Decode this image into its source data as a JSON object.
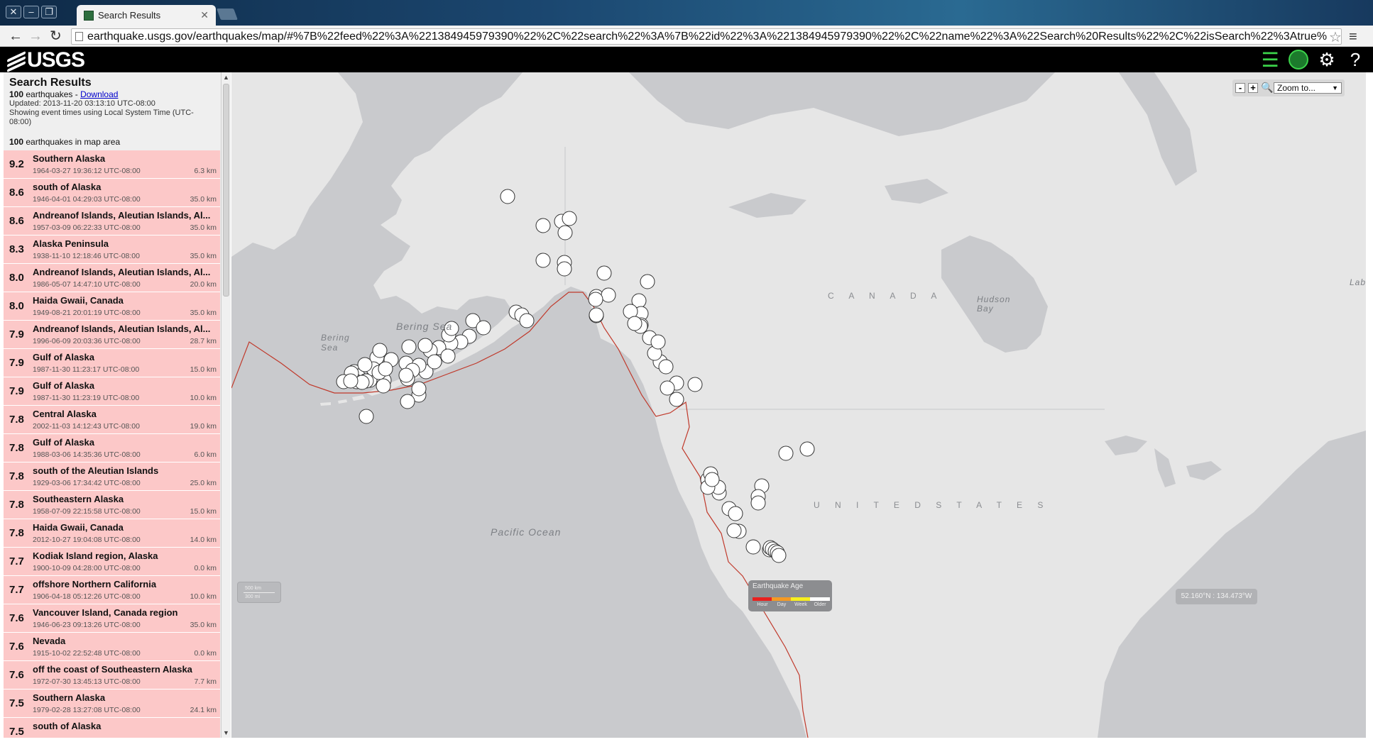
{
  "browser": {
    "tab_title": "Search Results",
    "url": "earthquake.usgs.gov/earthquakes/map/#%7B%22feed%22%3A%221384945979390%22%2C%22search%22%3A%7B%22id%22%3A%221384945979390%22%2C%22name%22%3A%22Search%20Results%22%2C%22isSearch%22%3Atrue%"
  },
  "header": {
    "logo": "USGS"
  },
  "sidebar": {
    "title": "Search Results",
    "count": "100",
    "count_suffix": " earthquakes - ",
    "download_label": "Download",
    "updated": "Updated: 2013-11-20 03:13:10 UTC-08:00",
    "timezone_note": "Showing event times using Local System Time (UTC-08:00)",
    "area_count": "100",
    "area_suffix": " earthquakes in map area",
    "earthquakes": [
      {
        "mag": "9.2",
        "place": "Southern Alaska",
        "time": "1964-03-27 19:36:12 UTC-08:00",
        "depth": "6.3 km"
      },
      {
        "mag": "8.6",
        "place": "south of Alaska",
        "time": "1946-04-01 04:29:03 UTC-08:00",
        "depth": "35.0 km"
      },
      {
        "mag": "8.6",
        "place": "Andreanof Islands, Aleutian Islands, Al...",
        "time": "1957-03-09 06:22:33 UTC-08:00",
        "depth": "35.0 km"
      },
      {
        "mag": "8.3",
        "place": "Alaska Peninsula",
        "time": "1938-11-10 12:18:46 UTC-08:00",
        "depth": "35.0 km"
      },
      {
        "mag": "8.0",
        "place": "Andreanof Islands, Aleutian Islands, Al...",
        "time": "1986-05-07 14:47:10 UTC-08:00",
        "depth": "20.0 km"
      },
      {
        "mag": "8.0",
        "place": "Haida Gwaii, Canada",
        "time": "1949-08-21 20:01:19 UTC-08:00",
        "depth": "35.0 km"
      },
      {
        "mag": "7.9",
        "place": "Andreanof Islands, Aleutian Islands, Al...",
        "time": "1996-06-09 20:03:36 UTC-08:00",
        "depth": "28.7 km"
      },
      {
        "mag": "7.9",
        "place": "Gulf of Alaska",
        "time": "1987-11-30 11:23:17 UTC-08:00",
        "depth": "15.0 km"
      },
      {
        "mag": "7.9",
        "place": "Gulf of Alaska",
        "time": "1987-11-30 11:23:19 UTC-08:00",
        "depth": "10.0 km"
      },
      {
        "mag": "7.8",
        "place": "Central Alaska",
        "time": "2002-11-03 14:12:43 UTC-08:00",
        "depth": "19.0 km"
      },
      {
        "mag": "7.8",
        "place": "Gulf of Alaska",
        "time": "1988-03-06 14:35:36 UTC-08:00",
        "depth": "6.0 km"
      },
      {
        "mag": "7.8",
        "place": "south of the Aleutian Islands",
        "time": "1929-03-06 17:34:42 UTC-08:00",
        "depth": "25.0 km"
      },
      {
        "mag": "7.8",
        "place": "Southeastern Alaska",
        "time": "1958-07-09 22:15:58 UTC-08:00",
        "depth": "15.0 km"
      },
      {
        "mag": "7.8",
        "place": "Haida Gwaii, Canada",
        "time": "2012-10-27 19:04:08 UTC-08:00",
        "depth": "14.0 km"
      },
      {
        "mag": "7.7",
        "place": "Kodiak Island region, Alaska",
        "time": "1900-10-09 04:28:00 UTC-08:00",
        "depth": "0.0 km"
      },
      {
        "mag": "7.7",
        "place": "offshore Northern California",
        "time": "1906-04-18 05:12:26 UTC-08:00",
        "depth": "10.0 km"
      },
      {
        "mag": "7.6",
        "place": "Vancouver Island, Canada region",
        "time": "1946-06-23 09:13:26 UTC-08:00",
        "depth": "35.0 km"
      },
      {
        "mag": "7.6",
        "place": "Nevada",
        "time": "1915-10-02 22:52:48 UTC-08:00",
        "depth": "0.0 km"
      },
      {
        "mag": "7.6",
        "place": "off the coast of Southeastern Alaska",
        "time": "1972-07-30 13:45:13 UTC-08:00",
        "depth": "7.7 km"
      },
      {
        "mag": "7.5",
        "place": "Southern Alaska",
        "time": "1979-02-28 13:27:08 UTC-08:00",
        "depth": "24.1 km"
      },
      {
        "mag": "7.5",
        "place": "south of Alaska",
        "time": "",
        "depth": ""
      }
    ]
  },
  "map": {
    "labels": {
      "canada": "C A N A D A",
      "us": "U N I T E D   S T A T E S",
      "bering_sea": "Bering Sea",
      "bering_sea_2a": "Bering",
      "bering_sea_2b": "Sea",
      "hudson_a": "Hudson",
      "hudson_b": "Bay",
      "pacific": "Pacific Ocean",
      "lab": "Lab"
    },
    "zoom_to": "Zoom to...",
    "zoom_minus": "-",
    "zoom_plus": "+",
    "scale_km": "500 km",
    "scale_mi": "300 mi",
    "legend": {
      "title": "Earthquake Age",
      "items": [
        {
          "label": "Hour",
          "color": "#e8211f"
        },
        {
          "label": "Day",
          "color": "#f59a24"
        },
        {
          "label": "Week",
          "color": "#f7ef1e"
        },
        {
          "label": "Older",
          "color": "#ffffff"
        }
      ]
    },
    "coords": "52.160°N : 134.473°W",
    "colors": {
      "land": "#e6e6e6",
      "water": "#c9cacd",
      "plate": "#c0392b"
    }
  }
}
